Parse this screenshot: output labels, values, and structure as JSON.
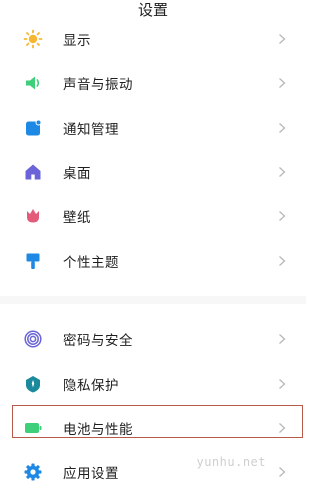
{
  "header": {
    "title": "设置"
  },
  "items": [
    {
      "label": "显示",
      "icon": "brightness-sun-icon",
      "color": "#f5b731"
    },
    {
      "label": "声音与振动",
      "icon": "speaker-icon",
      "color": "#3dcf7a"
    },
    {
      "label": "通知管理",
      "icon": "notification-icon",
      "color": "#1e88e5"
    },
    {
      "label": "桌面",
      "icon": "home-icon",
      "color": "#6a64d8"
    },
    {
      "label": "壁纸",
      "icon": "tulip-flower-icon",
      "color": "#e25b7b"
    },
    {
      "label": "个性主题",
      "icon": "paint-brush-icon",
      "color": "#1e88e5"
    },
    {
      "label": "密码与安全",
      "icon": "fingerprint-icon",
      "color": "#6a64d8"
    },
    {
      "label": "隐私保护",
      "icon": "privacy-shield-icon",
      "color": "#1b8a9c"
    },
    {
      "label": "电池与性能",
      "icon": "battery-icon",
      "color": "#3dcf7a"
    },
    {
      "label": "应用设置",
      "icon": "gear-icon",
      "color": "#1e88e5"
    }
  ],
  "watermark": "yunhu.net",
  "highlight_color": "#b85a4a"
}
